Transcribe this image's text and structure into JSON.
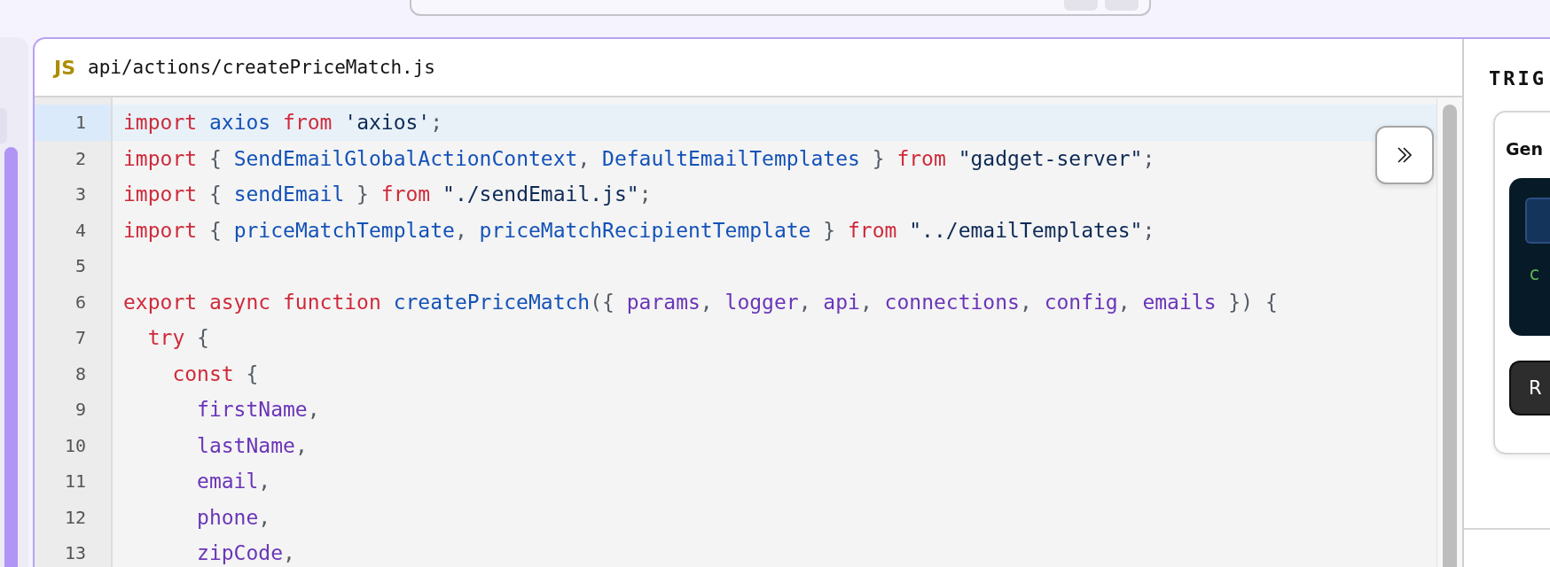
{
  "editor": {
    "language_badge": "JS",
    "path": "api/actions/createPriceMatch.js",
    "lines": [
      {
        "number": "1",
        "selected": true,
        "tokens": [
          {
            "kind": "keyword",
            "text": "import "
          },
          {
            "kind": "name",
            "text": "axios "
          },
          {
            "kind": "keyword",
            "text": "from "
          },
          {
            "kind": "string",
            "text": "'axios'"
          },
          {
            "kind": "punct",
            "text": ";"
          }
        ]
      },
      {
        "number": "2",
        "selected": false,
        "tokens": [
          {
            "kind": "keyword",
            "text": "import"
          },
          {
            "kind": "punct",
            "text": " { "
          },
          {
            "kind": "name",
            "text": "SendEmailGlobalActionContext"
          },
          {
            "kind": "punct",
            "text": ", "
          },
          {
            "kind": "name",
            "text": "DefaultEmailTemplates"
          },
          {
            "kind": "punct",
            "text": " } "
          },
          {
            "kind": "keyword",
            "text": "from "
          },
          {
            "kind": "string",
            "text": "\"gadget-server\""
          },
          {
            "kind": "punct",
            "text": ";"
          }
        ]
      },
      {
        "number": "3",
        "selected": false,
        "tokens": [
          {
            "kind": "keyword",
            "text": "import"
          },
          {
            "kind": "punct",
            "text": " { "
          },
          {
            "kind": "name",
            "text": "sendEmail"
          },
          {
            "kind": "punct",
            "text": " } "
          },
          {
            "kind": "keyword",
            "text": "from "
          },
          {
            "kind": "string",
            "text": "\"./sendEmail.js\""
          },
          {
            "kind": "punct",
            "text": ";"
          }
        ]
      },
      {
        "number": "4",
        "selected": false,
        "tokens": [
          {
            "kind": "keyword",
            "text": "import"
          },
          {
            "kind": "punct",
            "text": " { "
          },
          {
            "kind": "name",
            "text": "priceMatchTemplate"
          },
          {
            "kind": "punct",
            "text": ", "
          },
          {
            "kind": "name",
            "text": "priceMatchRecipientTemplate"
          },
          {
            "kind": "punct",
            "text": " } "
          },
          {
            "kind": "keyword",
            "text": "from "
          },
          {
            "kind": "string",
            "text": "\"../emailTemplates\""
          },
          {
            "kind": "punct",
            "text": ";"
          }
        ]
      },
      {
        "number": "5",
        "selected": false
      },
      {
        "number": "6",
        "selected": false,
        "tokens": [
          {
            "kind": "keyword",
            "text": "export async function "
          },
          {
            "kind": "name",
            "text": "createPriceMatch"
          },
          {
            "kind": "punct",
            "text": "({ "
          },
          {
            "kind": "variable",
            "text": "params"
          },
          {
            "kind": "punct",
            "text": ", "
          },
          {
            "kind": "variable",
            "text": "logger"
          },
          {
            "kind": "punct",
            "text": ", "
          },
          {
            "kind": "variable",
            "text": "api"
          },
          {
            "kind": "punct",
            "text": ", "
          },
          {
            "kind": "variable",
            "text": "connections"
          },
          {
            "kind": "punct",
            "text": ", "
          },
          {
            "kind": "variable",
            "text": "config"
          },
          {
            "kind": "punct",
            "text": ", "
          },
          {
            "kind": "variable",
            "text": "emails"
          },
          {
            "kind": "punct",
            "text": " }) {"
          }
        ]
      },
      {
        "number": "7",
        "selected": false,
        "tokens": [
          {
            "kind": "keyword",
            "text": "  try"
          },
          {
            "kind": "punct",
            "text": " {"
          }
        ]
      },
      {
        "number": "8",
        "selected": false,
        "tokens": [
          {
            "kind": "keyword",
            "text": "    const"
          },
          {
            "kind": "punct",
            "text": " {"
          }
        ]
      },
      {
        "number": "9",
        "selected": false,
        "tokens": [
          {
            "kind": "variable",
            "text": "      firstName"
          },
          {
            "kind": "punct",
            "text": ","
          }
        ]
      },
      {
        "number": "10",
        "selected": false,
        "tokens": [
          {
            "kind": "variable",
            "text": "      lastName"
          },
          {
            "kind": "punct",
            "text": ","
          }
        ]
      },
      {
        "number": "11",
        "selected": false,
        "tokens": [
          {
            "kind": "variable",
            "text": "      email"
          },
          {
            "kind": "punct",
            "text": ","
          }
        ]
      },
      {
        "number": "12",
        "selected": false,
        "tokens": [
          {
            "kind": "variable",
            "text": "      phone"
          },
          {
            "kind": "punct",
            "text": ","
          }
        ]
      },
      {
        "number": "13",
        "selected": false,
        "tokens": [
          {
            "kind": "variable",
            "text": "      zipCode"
          },
          {
            "kind": "punct",
            "text": ","
          }
        ]
      }
    ]
  },
  "side_panel": {
    "heading": "TRIG",
    "card_title": "Gen",
    "code_text": "c",
    "button_label": "R"
  }
}
